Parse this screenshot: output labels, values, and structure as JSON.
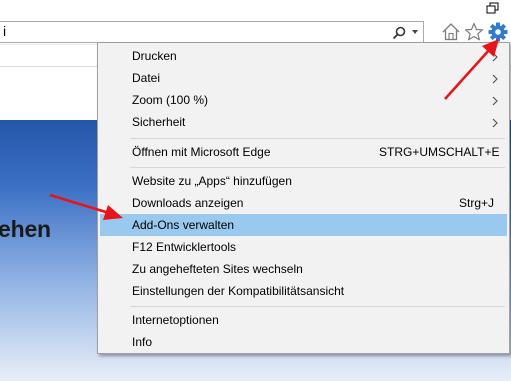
{
  "address_bar": {
    "value": "i"
  },
  "page": {
    "heading_fragment": "ehen"
  },
  "menu": {
    "items": [
      {
        "label": "Drucken",
        "submenu": true
      },
      {
        "label": "Datei",
        "submenu": true
      },
      {
        "label": "Zoom (100 %)",
        "submenu": true
      },
      {
        "label": "Sicherheit",
        "submenu": true
      },
      {
        "label": "Öffnen mit Microsoft Edge",
        "shortcut": "STRG+UMSCHALT+E"
      },
      {
        "label": "Website zu „Apps“ hinzufügen"
      },
      {
        "label": "Downloads anzeigen",
        "shortcut": "Strg+J"
      },
      {
        "label": "Add-Ons verwalten",
        "highlighted": true
      },
      {
        "label": "F12 Entwicklertools"
      },
      {
        "label": "Zu angehefteten Sites wechseln"
      },
      {
        "label": "Einstellungen der Kompatibilitätsansicht"
      },
      {
        "label": "Internetoptionen"
      },
      {
        "label": "Info"
      }
    ]
  },
  "icons": {
    "restore": "restore-icon",
    "search": "search-icon",
    "dropdown": "chevron-down-icon",
    "home": "home-icon",
    "favorites": "star-icon",
    "tools": "gear-icon",
    "submenu": "chevron-right-icon"
  },
  "colors": {
    "gear": "#2e7bcf",
    "highlight": "#99c9ef",
    "menu_background": "#f2f2f2",
    "arrow": "#e8141b",
    "page_blue": "#2456a8"
  }
}
